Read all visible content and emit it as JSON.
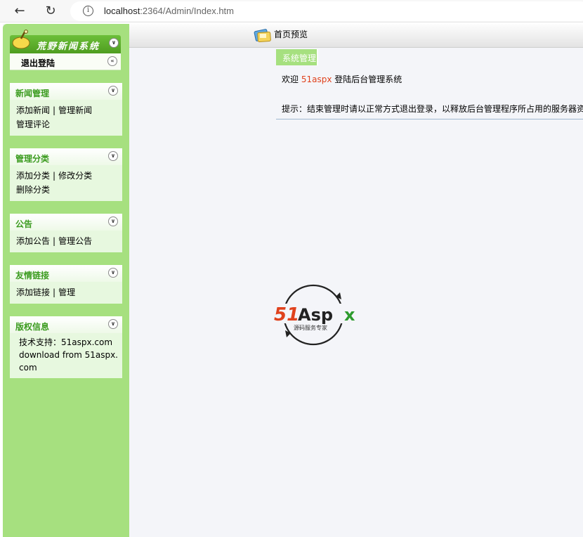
{
  "browser": {
    "url_host": "localhost",
    "url_rest": ":2364/Admin/Index.htm"
  },
  "sidebar": {
    "logo_text": "荒野新闻系统",
    "logout_label": "退出登陆",
    "panels": [
      {
        "title": "新闻管理",
        "links": [
          "添加新闻",
          "管理新闻",
          "管理评论"
        ]
      },
      {
        "title": "管理分类",
        "links": [
          "添加分类",
          "修改分类",
          "删除分类"
        ]
      },
      {
        "title": "公告",
        "links": [
          "添加公告",
          "管理公告"
        ]
      },
      {
        "title": "友情链接",
        "links": [
          "添加链接",
          "管理"
        ]
      }
    ],
    "copyright": {
      "title": "版权信息",
      "support": "技术支持：51aspx.com",
      "download": "download from 51aspx.com"
    },
    "separator": "|"
  },
  "header": {
    "preview_label": "首页预览"
  },
  "content": {
    "tab_label": "系统管理",
    "welcome_prefix": "欢迎 ",
    "welcome_brand": "51aspx",
    "welcome_suffix": " 登陆后台管理系统",
    "tip": "提示：结束管理时请以正常方式退出登录，以释放后台管理程序所占用的服务器资源"
  },
  "watermark": {
    "brand": "51Aspx",
    "slogan": "源码服务专家"
  },
  "colors": {
    "sidebar_green": "#a6e07f",
    "title_green": "#3b9b1f",
    "brand_red": "#e0421d"
  }
}
